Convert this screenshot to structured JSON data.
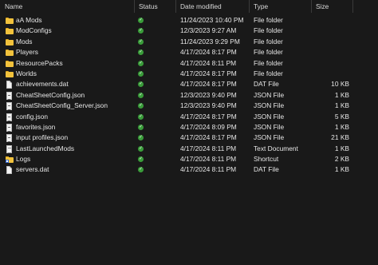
{
  "columns": {
    "name": "Name",
    "status": "Status",
    "date_modified": "Date modified",
    "type": "Type",
    "size": "Size"
  },
  "status_check": "✓",
  "files": [
    {
      "name": "aA Mods",
      "icon": "folder-icon",
      "date": "11/24/2023 10:40 PM",
      "type": "File folder",
      "size": ""
    },
    {
      "name": "ModConfigs",
      "icon": "folder-icon",
      "date": "12/3/2023 9:27 AM",
      "type": "File folder",
      "size": ""
    },
    {
      "name": "Mods",
      "icon": "folder-icon",
      "date": "11/24/2023 9:29 PM",
      "type": "File folder",
      "size": ""
    },
    {
      "name": "Players",
      "icon": "folder-icon",
      "date": "4/17/2024 8:17 PM",
      "type": "File folder",
      "size": ""
    },
    {
      "name": "ResourcePacks",
      "icon": "folder-icon",
      "date": "4/17/2024 8:11 PM",
      "type": "File folder",
      "size": ""
    },
    {
      "name": "Worlds",
      "icon": "folder-icon",
      "date": "4/17/2024 8:17 PM",
      "type": "File folder",
      "size": ""
    },
    {
      "name": "achievements.dat",
      "icon": "file-icon",
      "date": "4/17/2024 8:17 PM",
      "type": "DAT File",
      "size": "10 KB"
    },
    {
      "name": "CheatSheetConfig.json",
      "icon": "json-file-icon",
      "date": "12/3/2023 9:40 PM",
      "type": "JSON File",
      "size": "1 KB"
    },
    {
      "name": "CheatSheetConfig_Server.json",
      "icon": "json-file-icon",
      "date": "12/3/2023 9:40 PM",
      "type": "JSON File",
      "size": "1 KB"
    },
    {
      "name": "config.json",
      "icon": "json-file-icon",
      "date": "4/17/2024 8:17 PM",
      "type": "JSON File",
      "size": "5 KB"
    },
    {
      "name": "favorites.json",
      "icon": "json-file-icon",
      "date": "4/17/2024 8:09 PM",
      "type": "JSON File",
      "size": "1 KB"
    },
    {
      "name": "input profiles.json",
      "icon": "json-file-icon",
      "date": "4/17/2024 8:17 PM",
      "type": "JSON File",
      "size": "21 KB"
    },
    {
      "name": "LastLaunchedMods",
      "icon": "text-file-icon",
      "date": "4/17/2024 8:11 PM",
      "type": "Text Document",
      "size": "1 KB"
    },
    {
      "name": "Logs",
      "icon": "shortcut-icon",
      "date": "4/17/2024 8:11 PM",
      "type": "Shortcut",
      "size": "2 KB"
    },
    {
      "name": "servers.dat",
      "icon": "file-icon",
      "date": "4/17/2024 8:11 PM",
      "type": "DAT File",
      "size": "1 KB"
    }
  ]
}
